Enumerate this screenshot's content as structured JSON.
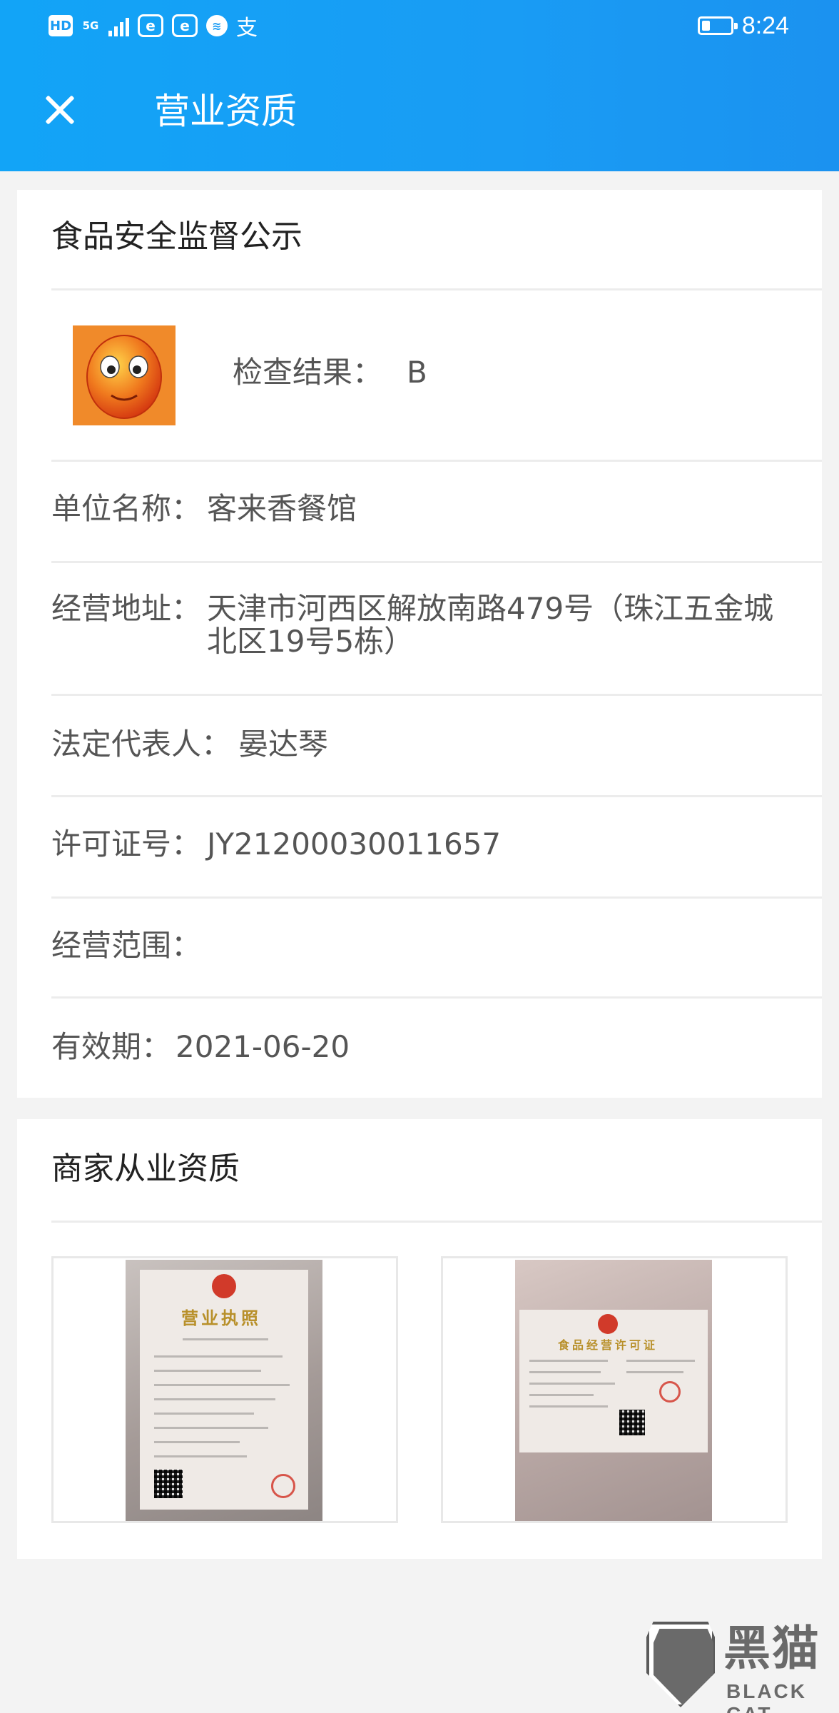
{
  "status_bar": {
    "hd": "HD",
    "network": "5G",
    "time": "8:24",
    "battery_level": 0.25,
    "icons": [
      "hd-icon",
      "signal-5g-icon",
      "eleme-icon",
      "eleme-icon",
      "voice-assistant-icon",
      "alipay-icon",
      "battery-icon"
    ]
  },
  "header": {
    "title": "营业资质",
    "close_icon": "close-icon"
  },
  "food_safety": {
    "section_title": "食品安全监督公示",
    "avatar_icon": "smiley-face-icon",
    "inspection_label": "检查结果：",
    "inspection_value": "B",
    "rows": [
      {
        "label": "单位名称：",
        "value": "客来香餐馆"
      },
      {
        "label": "经营地址：",
        "value": "天津市河西区解放南路479号（珠江五金城北区19号5栋）"
      },
      {
        "label": "法定代表人：",
        "value": "晏达琴"
      },
      {
        "label": "许可证号：",
        "value": "JY21200030011657"
      },
      {
        "label": "经营范围：",
        "value": ""
      },
      {
        "label": "有效期：",
        "value": "2021-06-20"
      }
    ]
  },
  "qualifications": {
    "section_title": "商家从业资质",
    "images": [
      {
        "heading": "营业执照"
      },
      {
        "heading": "食品经营许可证"
      }
    ]
  },
  "watermark": {
    "cn": "黑猫",
    "en": "BLACK CAT"
  }
}
